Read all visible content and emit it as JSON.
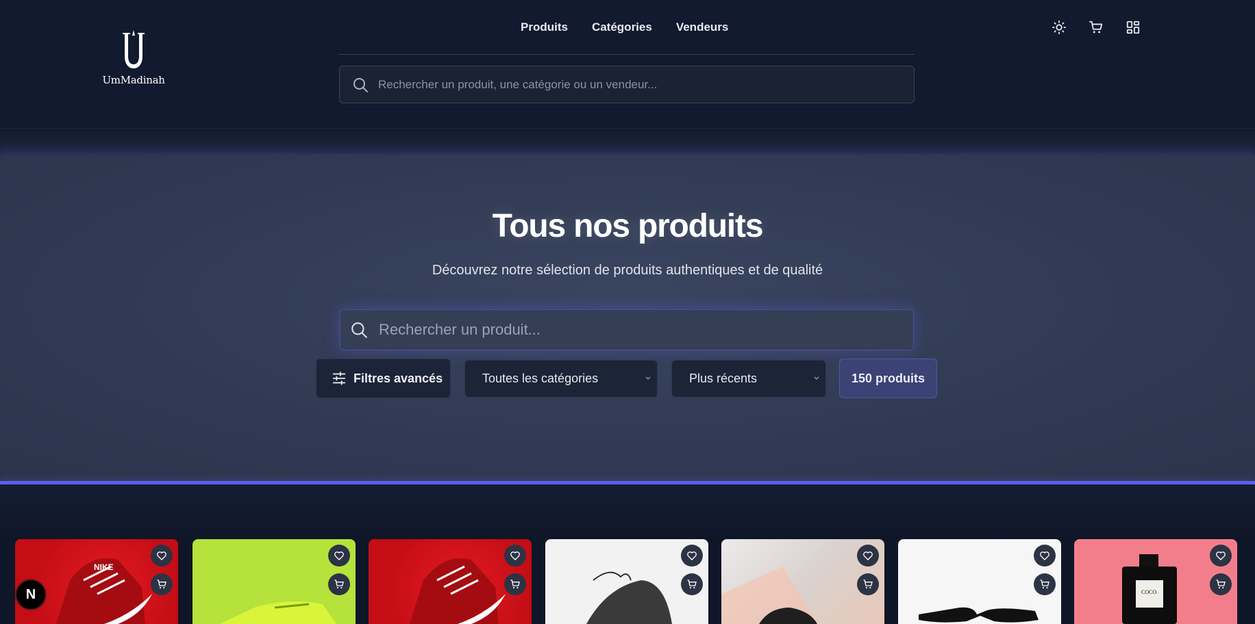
{
  "brand": {
    "name": "UmMadinah"
  },
  "nav": {
    "items": [
      "Produits",
      "Catégories",
      "Vendeurs"
    ]
  },
  "header_search": {
    "placeholder": "Rechercher un produit, une catégorie ou un vendeur..."
  },
  "header_icons": [
    "sun-icon",
    "cart-icon",
    "grid-icon"
  ],
  "hero": {
    "title": "Tous nos produits",
    "subtitle": "Découvrez notre sélection de produits authentiques et de qualité",
    "search_placeholder": "Rechercher un produit..."
  },
  "filters": {
    "advanced_label": "Filtres avancés",
    "category_selected": "Toutes les catégories",
    "sort_selected": "Plus récents",
    "count_label": "150 produits"
  },
  "dev_badge": "N",
  "colors": {
    "accent": "#5b5ff0",
    "background": "#0f1628",
    "hero": "#323c55"
  },
  "products": [
    {
      "image": "red nike sneaker on red background",
      "bg": "#d8121a"
    },
    {
      "image": "lime green sneaker on lime background",
      "bg": "#b7e33a"
    },
    {
      "image": "red nike sneaker on red background",
      "bg": "#d8121a"
    },
    {
      "image": "black sneaker on white background",
      "bg": "#f2f2f2"
    },
    {
      "image": "black shoe on pastel background",
      "bg": "#d9d6d4"
    },
    {
      "image": "black sunglasses on white background",
      "bg": "#f5f5f5"
    },
    {
      "image": "perfume bottle on pink background",
      "bg": "#f07d8a"
    }
  ]
}
